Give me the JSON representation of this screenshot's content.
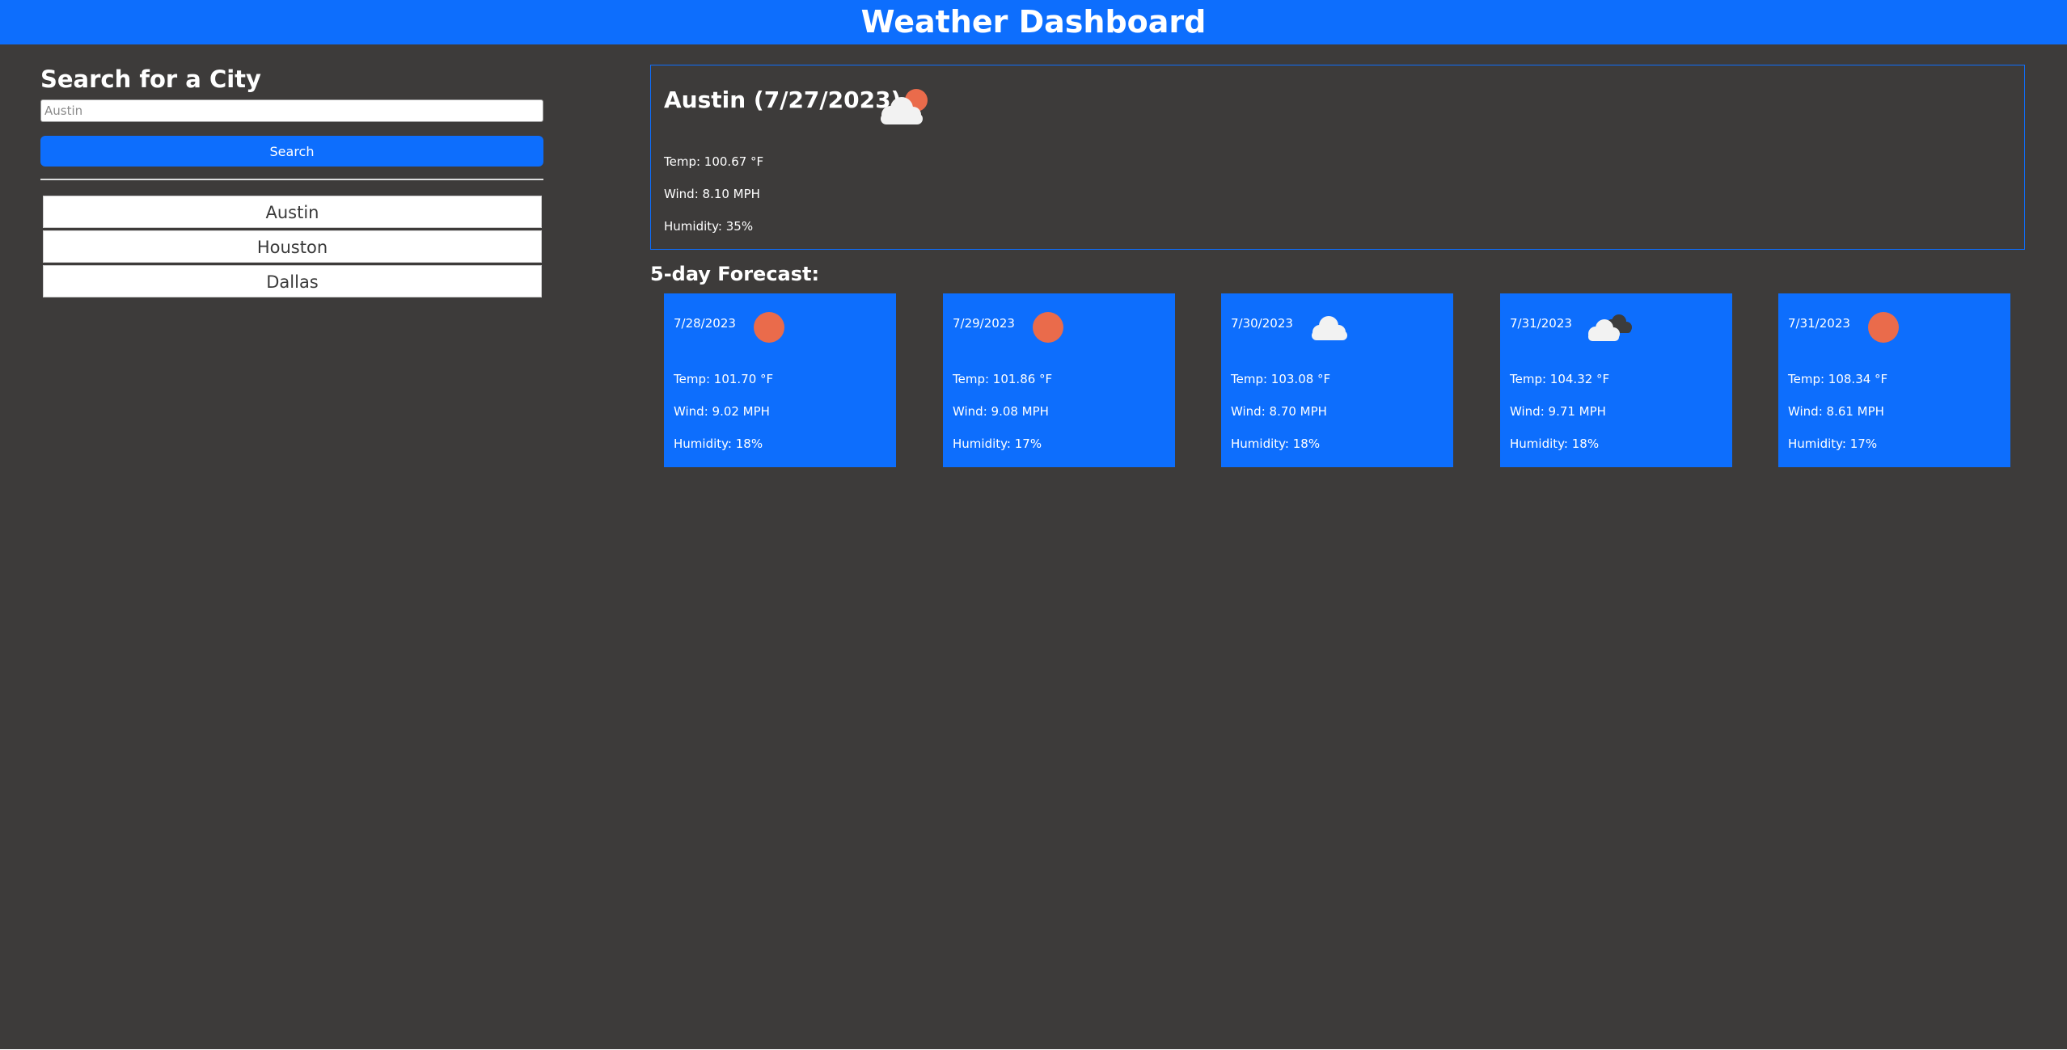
{
  "header": {
    "title": "Weather Dashboard"
  },
  "sidebar": {
    "title": "Search for a City",
    "search_value": "",
    "search_placeholder": "Austin",
    "search_button": "Search",
    "history": [
      "Austin",
      "Houston",
      "Dallas"
    ]
  },
  "current": {
    "title": "Austin (7/27/2023)",
    "icon": "sun-behind-cloud-icon",
    "temp": "Temp: 100.67 °F",
    "wind": "Wind: 8.10 MPH",
    "humidity": "Humidity: 35%"
  },
  "forecast": {
    "title": "5-day Forecast:",
    "days": [
      {
        "date": "7/28/2023",
        "icon": "sun-icon",
        "temp": "Temp: 101.70 °F",
        "wind": "Wind: 9.02 MPH",
        "humidity": "Humidity: 18%"
      },
      {
        "date": "7/29/2023",
        "icon": "sun-icon",
        "temp": "Temp: 101.86 °F",
        "wind": "Wind: 9.08 MPH",
        "humidity": "Humidity: 17%"
      },
      {
        "date": "7/30/2023",
        "icon": "cloud-icon",
        "temp": "Temp: 103.08 °F",
        "wind": "Wind: 8.70 MPH",
        "humidity": "Humidity: 18%"
      },
      {
        "date": "7/31/2023",
        "icon": "broken-clouds-icon",
        "temp": "Temp: 104.32 °F",
        "wind": "Wind: 9.71 MPH",
        "humidity": "Humidity: 18%"
      },
      {
        "date": "7/31/2023",
        "icon": "sun-icon",
        "temp": "Temp: 108.34 °F",
        "wind": "Wind: 8.61 MPH",
        "humidity": "Humidity: 17%"
      }
    ]
  },
  "colors": {
    "accent": "#0d6efd",
    "background": "#3d3b3a",
    "sun": "#ea6b4b",
    "cloud": "#f2f2f2",
    "dark_cloud": "#3c3c3c"
  }
}
